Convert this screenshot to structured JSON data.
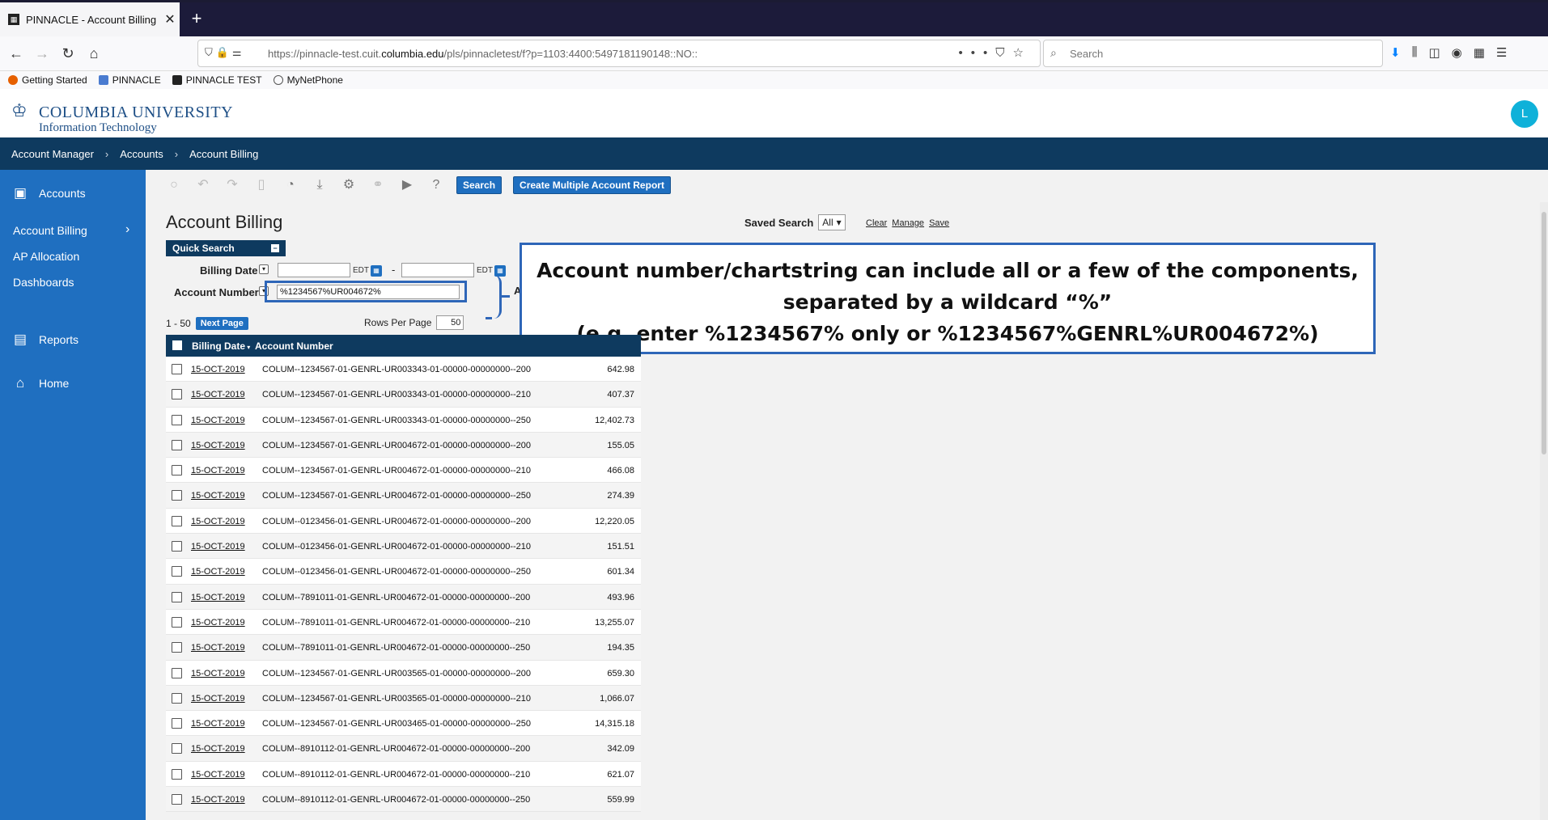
{
  "browser": {
    "tab_title": "PINNACLE - Account Billing",
    "new_tab": "+",
    "url_prefix": "https://pinnacle-test.cuit.",
    "url_domain": "columbia.edu",
    "url_suffix": "/pls/pinnacletest/f?p=1103:4400:5497181190148::NO::",
    "search_placeholder": "Search",
    "bookmarks": [
      "Getting Started",
      "PINNACLE",
      "PINNACLE TEST",
      "MyNetPhone"
    ]
  },
  "header": {
    "logo_main": "COLUMBIA UNIVERSITY",
    "logo_sub": "Information Technology",
    "avatar_initial": "L"
  },
  "breadcrumb": [
    "Account Manager",
    "Accounts",
    "Account Billing"
  ],
  "sidebar": {
    "accounts": "Accounts",
    "account_billing": "Account Billing",
    "ap_allocation": "AP Allocation",
    "dashboards": "Dashboards",
    "reports": "Reports",
    "home": "Home"
  },
  "toolbar": {
    "search_label": "Search",
    "create_multiple_label": "Create Multiple Account Report"
  },
  "main": {
    "title": "Account Billing",
    "saved_search_label": "Saved Search",
    "saved_search_value": "All",
    "links": [
      "Clear",
      "Manage",
      "Save"
    ],
    "quick_search_label": "Quick Search",
    "billing_date_label": "Billing Date",
    "edt": "EDT",
    "date_sep": "-",
    "account_number_label": "Account Number",
    "account_number_value": "%1234567%UR004672%",
    "hidden_a": "A",
    "range_text": "1 - 50",
    "next_page": "Next Page",
    "rows_per_page_label": "Rows Per Page",
    "rows_per_page_value": "50"
  },
  "callout": {
    "line1": "Account number/chartstring can include all or a few of the components,",
    "line2": "separated by a wildcard “%”",
    "line3": "(e.g. enter %1234567% only or %1234567%GENRL%UR004672%)"
  },
  "table": {
    "headers": [
      "Billing Date",
      "Account Number"
    ],
    "rows": [
      {
        "date": "15-OCT-2019",
        "account": "COLUM--1234567-01-GENRL-UR003343-01-00000-00000000--200",
        "amount": "642.98"
      },
      {
        "date": "15-OCT-2019",
        "account": "COLUM--1234567-01-GENRL-UR003343-01-00000-00000000--210",
        "amount": "407.37"
      },
      {
        "date": "15-OCT-2019",
        "account": "COLUM--1234567-01-GENRL-UR003343-01-00000-00000000--250",
        "amount": "12,402.73"
      },
      {
        "date": "15-OCT-2019",
        "account": "COLUM--1234567-01-GENRL-UR004672-01-00000-00000000--200",
        "amount": "155.05"
      },
      {
        "date": "15-OCT-2019",
        "account": "COLUM--1234567-01-GENRL-UR004672-01-00000-00000000--210",
        "amount": "466.08"
      },
      {
        "date": "15-OCT-2019",
        "account": "COLUM--1234567-01-GENRL-UR004672-01-00000-00000000--250",
        "amount": "274.39"
      },
      {
        "date": "15-OCT-2019",
        "account": "COLUM--0123456-01-GENRL-UR004672-01-00000-00000000--200",
        "amount": "12,220.05"
      },
      {
        "date": "15-OCT-2019",
        "account": "COLUM--0123456-01-GENRL-UR004672-01-00000-00000000--210",
        "amount": "151.51"
      },
      {
        "date": "15-OCT-2019",
        "account": "COLUM--0123456-01-GENRL-UR004672-01-00000-00000000--250",
        "amount": "601.34"
      },
      {
        "date": "15-OCT-2019",
        "account": "COLUM--7891011-01-GENRL-UR004672-01-00000-00000000--200",
        "amount": "493.96"
      },
      {
        "date": "15-OCT-2019",
        "account": "COLUM--7891011-01-GENRL-UR004672-01-00000-00000000--210",
        "amount": "13,255.07"
      },
      {
        "date": "15-OCT-2019",
        "account": "COLUM--7891011-01-GENRL-UR004672-01-00000-00000000--250",
        "amount": "194.35"
      },
      {
        "date": "15-OCT-2019",
        "account": "COLUM--1234567-01-GENRL-UR003565-01-00000-00000000--200",
        "amount": "659.30"
      },
      {
        "date": "15-OCT-2019",
        "account": "COLUM--1234567-01-GENRL-UR003565-01-00000-00000000--210",
        "amount": "1,066.07"
      },
      {
        "date": "15-OCT-2019",
        "account": "COLUM--1234567-01-GENRL-UR003465-01-00000-00000000--250",
        "amount": "14,315.18"
      },
      {
        "date": "15-OCT-2019",
        "account": "COLUM--8910112-01-GENRL-UR004672-01-00000-00000000--200",
        "amount": "342.09"
      },
      {
        "date": "15-OCT-2019",
        "account": "COLUM--8910112-01-GENRL-UR004672-01-00000-00000000--210",
        "amount": "621.07"
      },
      {
        "date": "15-OCT-2019",
        "account": "COLUM--8910112-01-GENRL-UR004672-01-00000-00000000--250",
        "amount": "559.99"
      }
    ]
  }
}
